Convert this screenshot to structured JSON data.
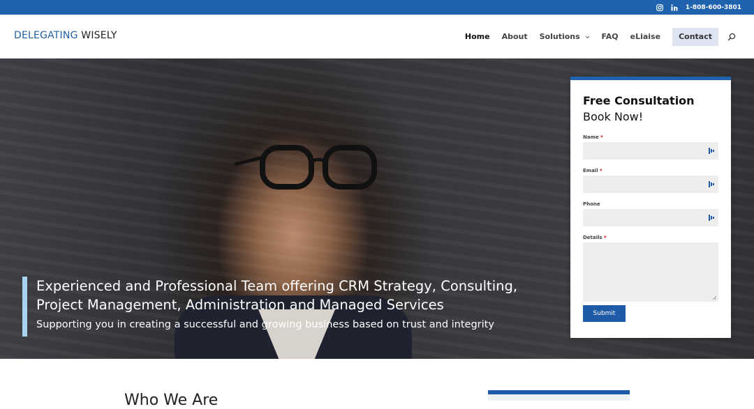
{
  "topbar": {
    "icons": [
      "instagram-icon",
      "linkedin-icon"
    ],
    "phone": "1-808-600-3801",
    "color": "#1f62ae"
  },
  "header": {
    "logo_part1": "DELEGATING",
    "logo_part2": "WISELY",
    "nav": {
      "home": "Home",
      "about": "About",
      "solutions": "Solutions",
      "faq": "FAQ",
      "eliaise": "eLiaise",
      "contact": "Contact"
    }
  },
  "hero": {
    "title_line1": "Experienced and Professional Team offering CRM Strategy, Consulting,",
    "title_line2": "Project Management, Administration and Managed Services",
    "subtitle": "Supporting you in creating a successful and growing business based on trust and integrity",
    "accent_color": "#a9d3ee"
  },
  "form": {
    "title": "Free Consultation",
    "subtitle": "Book Now!",
    "name_label": "Name",
    "email_label": "Email",
    "phone_label": "Phone",
    "details_label": "Details",
    "required_mark": "*",
    "submit_label": "Submit"
  },
  "section": {
    "heading": "Who We Are"
  }
}
